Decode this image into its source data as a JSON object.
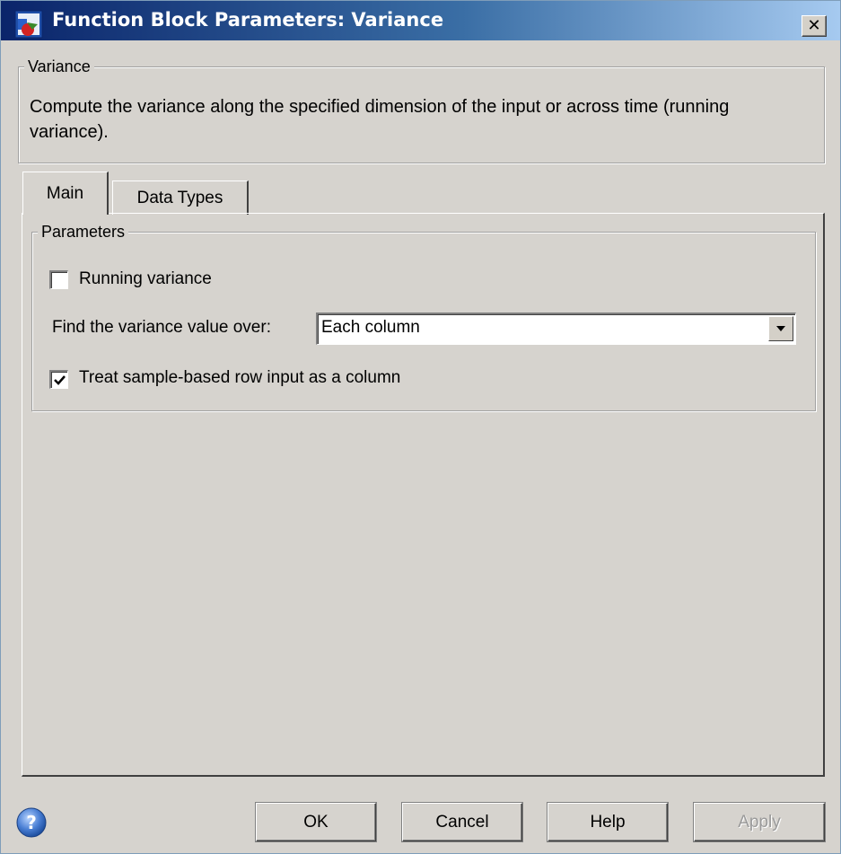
{
  "window": {
    "title": "Function Block Parameters: Variance",
    "close_label": "✕",
    "icon": "simulink-block-icon"
  },
  "description_group": {
    "legend": "Variance",
    "text": "Compute the variance along the specified dimension of the input or across time (running variance)."
  },
  "tabs": [
    {
      "label": "Main",
      "selected": true
    },
    {
      "label": "Data Types",
      "selected": false
    }
  ],
  "parameters": {
    "legend": "Parameters",
    "running_variance": {
      "label": "Running variance",
      "checked": false
    },
    "find_over": {
      "label": "Find the variance value over:",
      "value": "Each column"
    },
    "treat_row_as_column": {
      "label": "Treat sample-based row input as a column",
      "checked": true
    }
  },
  "buttons": {
    "ok": "OK",
    "cancel": "Cancel",
    "help": "Help",
    "apply": "Apply",
    "apply_enabled": false
  },
  "colors": {
    "dialog_bg": "#d6d3ce",
    "title_gradient_start": "#0a246a",
    "title_gradient_end": "#a6caf0"
  }
}
